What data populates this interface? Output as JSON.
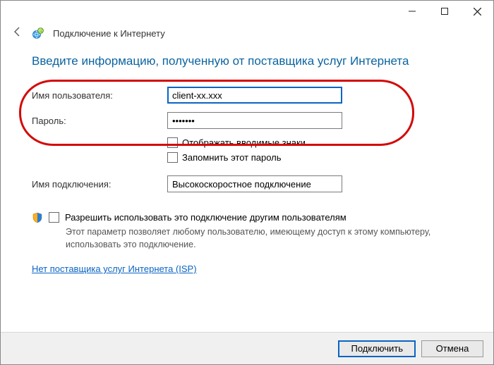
{
  "window": {
    "title": "Подключение к Интернету"
  },
  "heading": "Введите информацию, полученную от поставщика услуг Интернета",
  "form": {
    "username_label": "Имя пользователя:",
    "username_value": "client-xx.xxx",
    "password_label": "Пароль:",
    "password_value": "•••••••",
    "show_chars_label": "Отображать вводимые знаки",
    "remember_label": "Запомнить этот пароль",
    "conn_name_label": "Имя подключения:",
    "conn_name_value": "Высокоскоростное подключение"
  },
  "allow": {
    "checkbox_label": "Разрешить использовать это подключение другим пользователям",
    "description": "Этот параметр позволяет любому пользователю, имеющему доступ к этому компьютеру, использовать это подключение."
  },
  "link_text": "Нет поставщика услуг Интернета (ISP)",
  "buttons": {
    "connect": "Подключить",
    "cancel": "Отмена"
  }
}
